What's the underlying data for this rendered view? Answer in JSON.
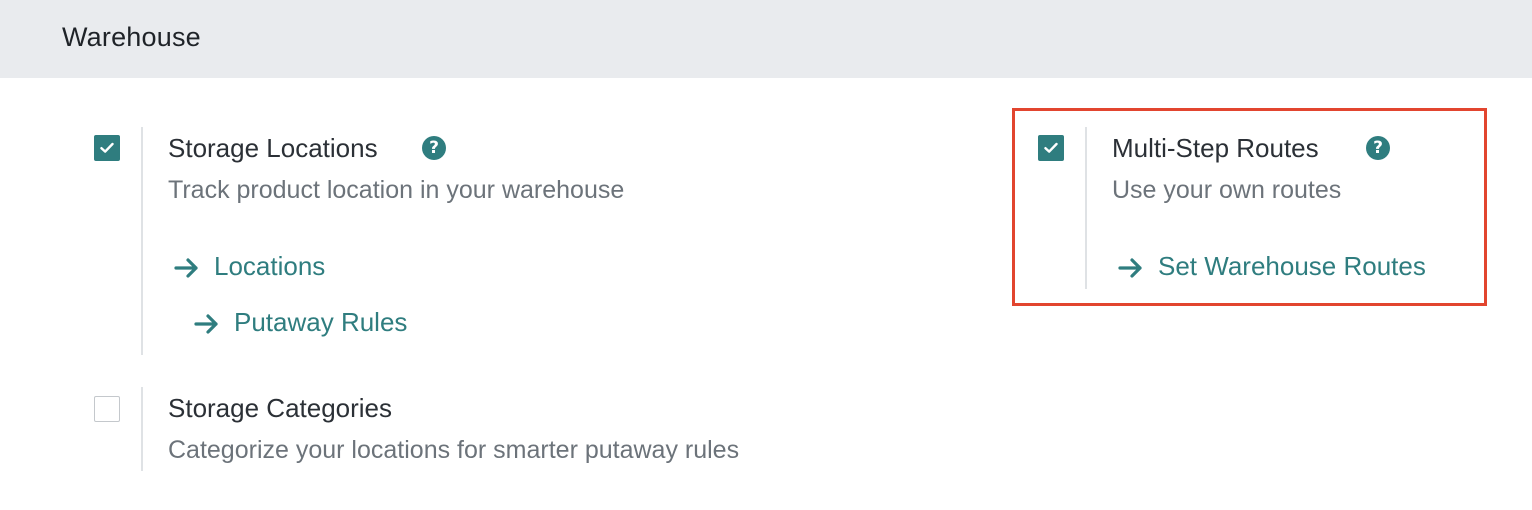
{
  "section": {
    "title": "Warehouse"
  },
  "settings": {
    "storage_locations": {
      "title": "Storage Locations",
      "description": "Track product location in your warehouse",
      "checked": true,
      "links": [
        {
          "label": "Locations"
        },
        {
          "label": "Putaway Rules"
        }
      ]
    },
    "storage_categories": {
      "title": "Storage Categories",
      "description": "Categorize your locations for smarter putaway rules",
      "checked": false
    },
    "multi_step_routes": {
      "title": "Multi-Step Routes",
      "description": "Use your own routes",
      "checked": true,
      "links": [
        {
          "label": "Set Warehouse Routes"
        }
      ]
    }
  },
  "icons": {
    "help": "question-circle-icon",
    "arrow": "arrow-right-icon",
    "check": "check-icon"
  },
  "colors": {
    "accent": "#2f7d7f",
    "header_bg": "#e9ebee",
    "highlight": "#e2452f",
    "muted_text": "#6c737a"
  }
}
